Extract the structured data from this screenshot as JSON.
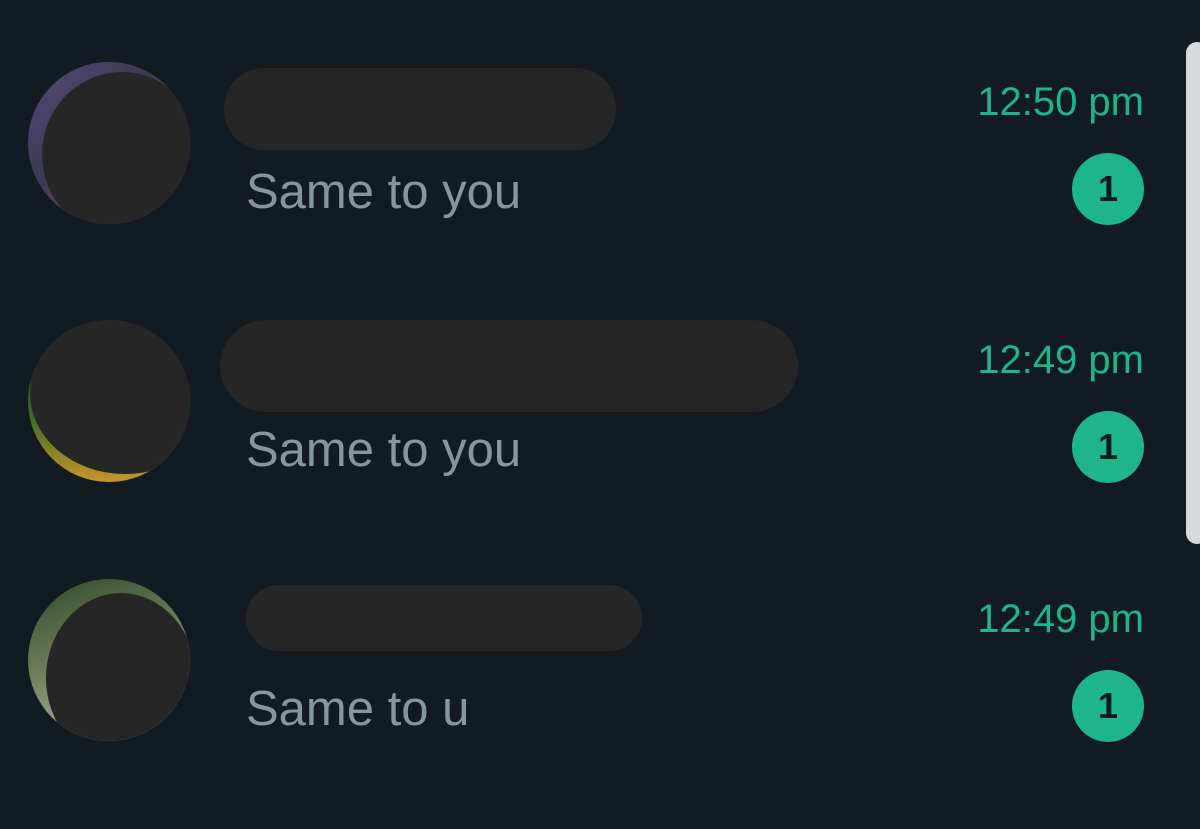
{
  "chats": [
    {
      "preview": "Same to you",
      "time": "12:50 pm",
      "unread": "1"
    },
    {
      "preview": "Same to you",
      "time": "12:49 pm",
      "unread": "1"
    },
    {
      "preview": "Same to u",
      "time": "12:49 pm",
      "unread": "1"
    }
  ],
  "colors": {
    "background": "#111b21",
    "accent": "#1fb58a",
    "preview_text": "#8696a0",
    "redaction": "#262626"
  }
}
